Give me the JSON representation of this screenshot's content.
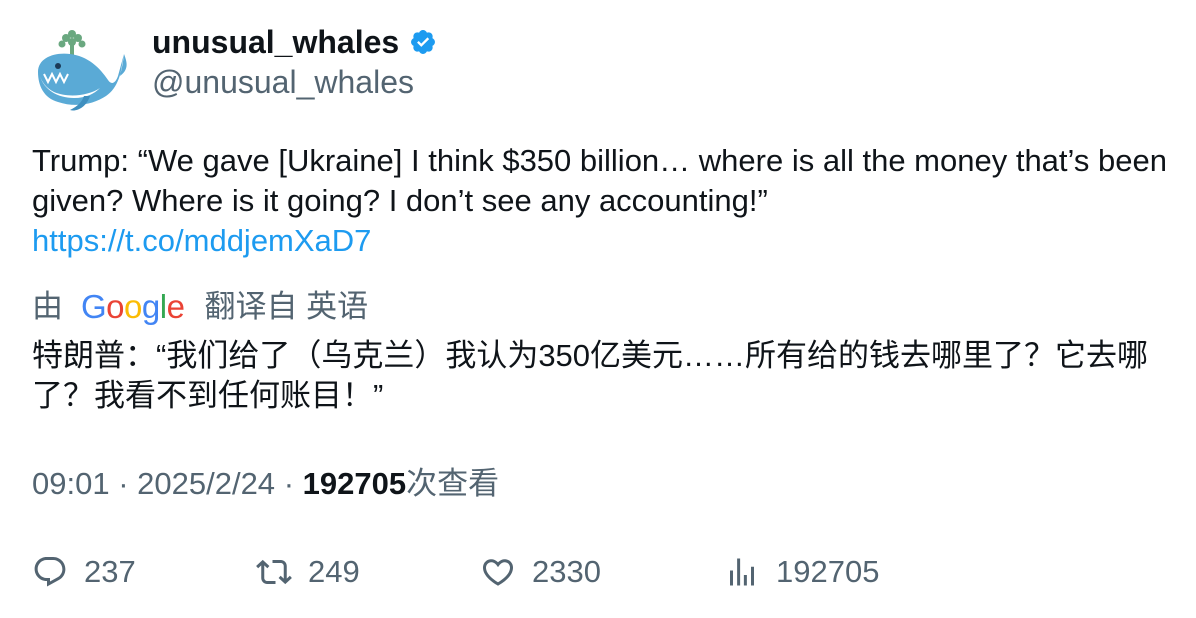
{
  "author": {
    "name": "unusual_whales",
    "handle": "@unusual_whales",
    "verified": true,
    "avatar_icon": "whale-logo",
    "badge_color": "#1d9bf0"
  },
  "tweet": {
    "text": "Trump: “We gave [Ukraine] I think $350 billion… where is all the money that’s been given? Where is it going? I don’t see any accounting!”",
    "link": "https://t.co/mddjemXaD7"
  },
  "translation": {
    "prefix": "由",
    "brand": "Google",
    "suffix": "翻译自 英语",
    "text": "特朗普：“我们给了（乌克兰）我认为350亿美元……所有给的钱去哪里了？它去哪了？我看不到任何账目！”"
  },
  "meta": {
    "time": "09:01",
    "date": "2025/2/24",
    "views_count": "192705",
    "views_label": "次查看"
  },
  "actions": {
    "replies": "237",
    "retweets": "249",
    "likes": "2330",
    "views": "192705"
  },
  "colors": {
    "text": "#0f1419",
    "secondary": "#536471",
    "link": "#1d9bf0"
  }
}
